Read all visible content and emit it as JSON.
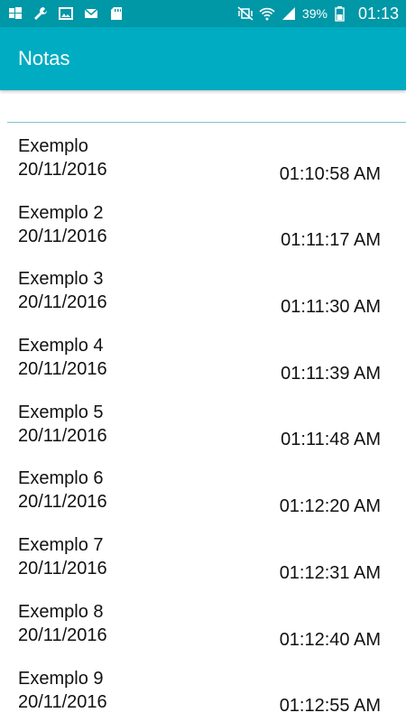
{
  "status_bar": {
    "battery_percent": "39%",
    "time": "01:13",
    "icons_left": [
      "windows-store-icon",
      "wrench-icon",
      "image-icon",
      "mail-icon",
      "sd-card-icon"
    ],
    "icons_right": [
      "vibrate-mute-icon",
      "wifi-icon",
      "signal-icon",
      "battery-icon"
    ]
  },
  "app_bar": {
    "title": "Notas"
  },
  "search": {
    "value": "",
    "placeholder": ""
  },
  "notes": [
    {
      "title": "Exemplo",
      "date": "20/11/2016",
      "time": "01:10:58 AM"
    },
    {
      "title": "Exemplo 2",
      "date": "20/11/2016",
      "time": "01:11:17 AM"
    },
    {
      "title": "Exemplo 3",
      "date": "20/11/2016",
      "time": "01:11:30 AM"
    },
    {
      "title": "Exemplo 4",
      "date": "20/11/2016",
      "time": "01:11:39 AM"
    },
    {
      "title": "Exemplo 5",
      "date": "20/11/2016",
      "time": "01:11:48 AM"
    },
    {
      "title": "Exemplo 6",
      "date": "20/11/2016",
      "time": "01:12:20 AM"
    },
    {
      "title": "Exemplo 7",
      "date": "20/11/2016",
      "time": "01:12:31 AM"
    },
    {
      "title": "Exemplo 8",
      "date": "20/11/2016",
      "time": "01:12:40 AM"
    },
    {
      "title": "Exemplo 9",
      "date": "20/11/2016",
      "time": "01:12:55 AM"
    }
  ],
  "colors": {
    "status_bar": "#0097a7",
    "app_bar": "#00acc1",
    "divider": "#7fc6cf"
  }
}
